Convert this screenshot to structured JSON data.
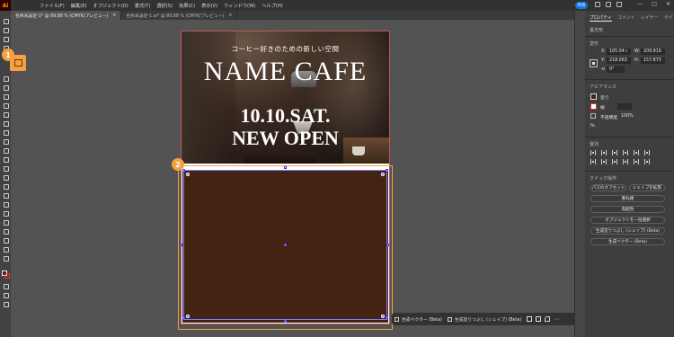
{
  "app": {
    "logo": "Ai",
    "menus": [
      "ファイル(F)",
      "編集(E)",
      "オブジェクト(O)",
      "書式(T)",
      "選択(S)",
      "効果(C)",
      "表示(V)",
      "ウィンドウ(W)",
      "ヘルプ(H)"
    ],
    "share_label": "共有",
    "window_controls": [
      "—",
      "□",
      "✕"
    ]
  },
  "tabs": [
    {
      "label": "名称未設定-1* @ 89.88 % (CMYK/プレビュー)",
      "close": "×",
      "active": true
    },
    {
      "label": "名称未設定-1.ai* @ 89.88 % (CMYK/プレビュー)",
      "close": "×",
      "active": false
    }
  ],
  "badges": {
    "one": "1",
    "two": "2"
  },
  "artwork": {
    "tagline": "コーヒー好きのための新しい空間",
    "cafe_name": "NAME CAFE",
    "date": "10.10.SAT.",
    "open_text": "NEW OPEN",
    "fill_color": "#452312"
  },
  "context_bar": {
    "gen_vector": "生成ベクター (Beta)",
    "gen_fill": "生成塗りつぶし (シェイプ) (Beta)",
    "more": "⋯"
  },
  "panel": {
    "tabs": [
      "プロパティ",
      "コメント",
      "レイヤー",
      "ライブラリ"
    ],
    "selection_title": "長方形",
    "transform_title": "変形",
    "x_label": "X:",
    "x_value": "105.04 r",
    "y_label": "Y:",
    "y_value": "218.063",
    "w_label": "W:",
    "w_value": "209.919",
    "h_label": "H:",
    "h_value": "157.873",
    "angle_value": "0°",
    "appearance_title": "アピアランス",
    "fill_label": "塗り",
    "stroke_label": "線",
    "opacity_label": "不透明度",
    "opacity_value": "100%",
    "fx_label": "fx.",
    "align_title": "整列",
    "quick_actions_title": "クイック操作",
    "btn_offset": "パスのオフセット",
    "btn_expand": "シェイプを拡張",
    "btn_arrange": "重ね順",
    "btn_recolor": "再配色",
    "btn_select_same": "オブジェクトを一括選択",
    "btn_gen_fill": "生成塗りつぶし (シェイプ) (Beta)",
    "btn_gen_vector": "生成ベクター (Beta)"
  }
}
